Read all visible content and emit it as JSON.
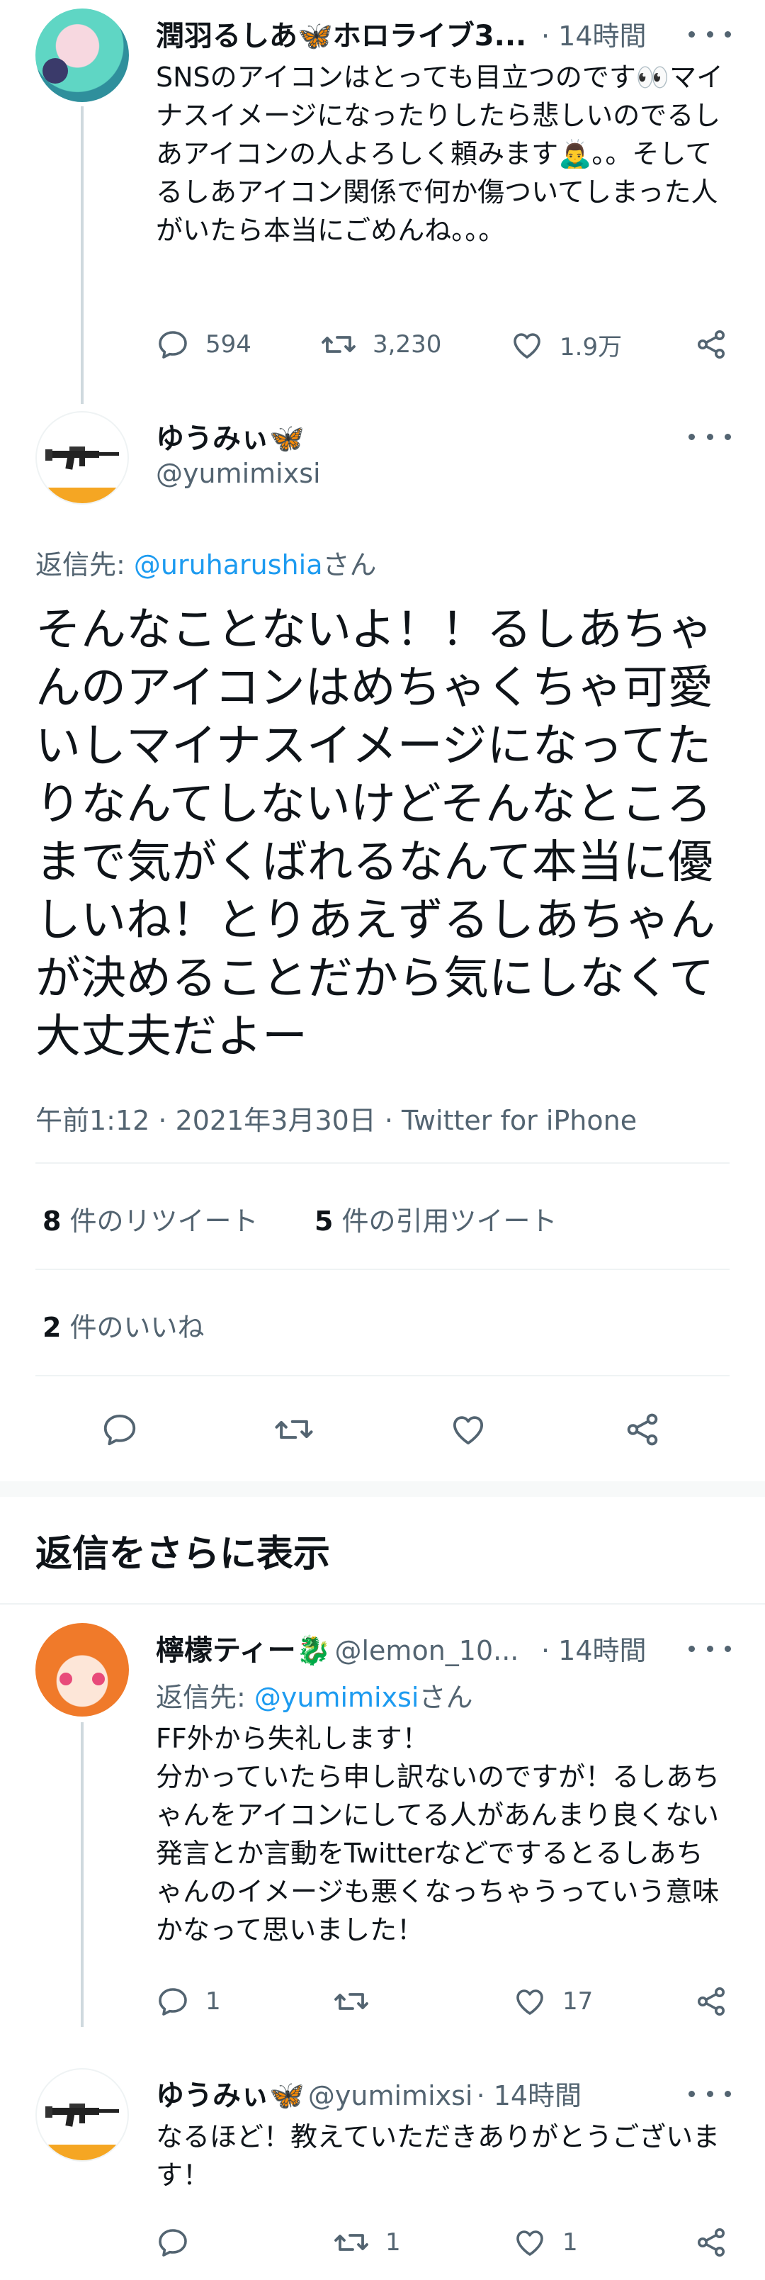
{
  "tweet1": {
    "name": "潤羽るしあ🦋ホロライブ3...",
    "time": "· 14時間",
    "text": "SNSのアイコンはとっても目立つのです👀マイナスイメージになったりしたら悲しいのでるしあアイコンの人よろしく頼みます🙇‍♂️。。そしてるしあアイコン関係で何か傷ついてしまった人がいたら本当にごめんね。。。",
    "replies": "594",
    "retweets": "3,230",
    "likes": "1.9万"
  },
  "main": {
    "name": "ゆうみぃ🦋",
    "handle": "@yumimixsi",
    "reply_prefix": "返信先: ",
    "reply_handle": "@uruharushia",
    "reply_suffix": "さん",
    "text": "そんなことないよ！！るしあちゃんのアイコンはめちゃくちゃ可愛いしマイナスイメージになってたりなんてしないけどそんなところまで気がくばれるなんて本当に優しいね！とりあえずるしあちゃんが決めることだから気にしなくて大丈夫だよー",
    "meta": "午前1:12 · 2021年3月30日 · Twitter for iPhone",
    "retweet_count": "8",
    "retweet_label": " 件のリツイート",
    "quote_count": "5",
    "quote_label": " 件の引用ツイート",
    "like_count": "2",
    "like_label": " 件のいいね"
  },
  "more_replies_title": "返信をさらに表示",
  "reply1": {
    "name": "檸檬ティー🐉",
    "handle": "@lemon_10...",
    "time": "· 14時間",
    "reply_prefix": "返信先: ",
    "reply_handle": "@yumimixsi",
    "reply_suffix": "さん",
    "text": "FF外から失礼します！\n分かっていたら申し訳ないのですが！るしあちゃんをアイコンにしてる人があんまり良くない発言とか言動をTwitterなどでするとるしあちゃんのイメージも悪くなっちゃうっていう意味かなって思いました！",
    "replies": "1",
    "retweets": "",
    "likes": "17"
  },
  "reply2": {
    "name": "ゆうみぃ🦋",
    "handle": "@yumimixsi",
    "time": "· 14時間",
    "text": "なるほど！教えていただきありがとうございます！",
    "replies": "",
    "retweets": "1",
    "likes": "1"
  },
  "icons": [
    "reply-icon",
    "retweet-icon",
    "like-icon",
    "share-icon",
    "more-icon"
  ],
  "colors": {
    "link": "#1d9bf0",
    "secondary": "#536471",
    "divider": "#eff3f4"
  }
}
